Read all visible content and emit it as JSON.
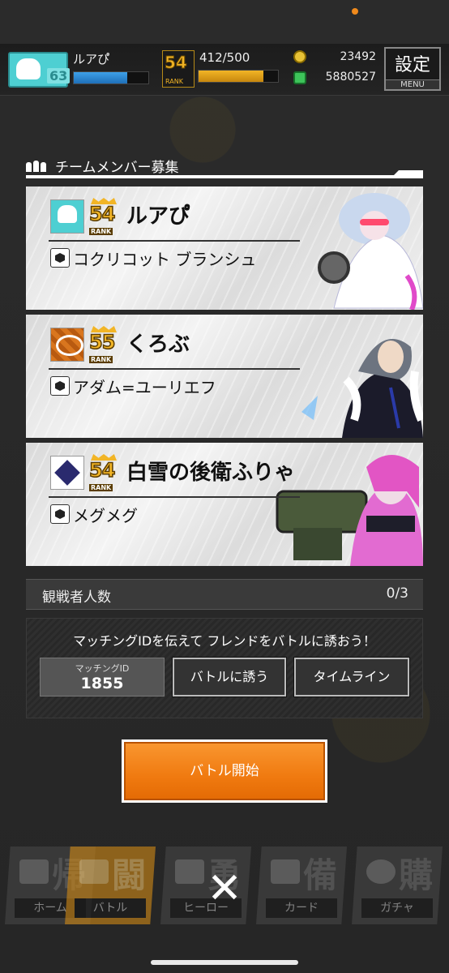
{
  "header": {
    "player_name": "ルアぴ゚",
    "level": "63",
    "xp_progress": 0.72,
    "rank_number": "54",
    "rank_label": "RANK",
    "rank_progress_text": "412/500",
    "rank_progress": 0.82,
    "coins": "23492",
    "cash": "5880527",
    "menu_big": "設定",
    "menu_small": "MENU"
  },
  "section": {
    "title": "チームメンバー募集"
  },
  "members": [
    {
      "name": "ルアぴ゚",
      "rank_number": "54",
      "rank_label": "RANK",
      "hero": "コクリコット ブランシュ",
      "avatar_color": "#4ecfd2"
    },
    {
      "name": "くろぶ",
      "rank_number": "55",
      "rank_label": "RANK",
      "hero": "アダム=ユーリエフ",
      "avatar_color": "#d9761e"
    },
    {
      "name": "白雪の後衛ふりゃ",
      "rank_number": "54",
      "rank_label": "RANK",
      "hero": "メグメグ",
      "avatar_color": "#2a2a6e"
    }
  ],
  "spectators": {
    "label": "観戦者人数",
    "count": "0/3"
  },
  "matching": {
    "message": "マッチングIDを伝えて フレンドをバトルに誘おう！",
    "id_label": "マッチングID",
    "id_value": "1855",
    "invite_button": "バトルに誘う",
    "timeline_button": "タイムライン"
  },
  "start_button": "バトル開始",
  "nav": {
    "tabs": [
      {
        "label": "ホーム",
        "kanji": "帰"
      },
      {
        "label": "バトル",
        "kanji": "闘"
      },
      {
        "label": "ヒーロー",
        "kanji": "勇"
      },
      {
        "label": "カード",
        "kanji": "備"
      },
      {
        "label": "ガチャ",
        "kanji": "購"
      }
    ],
    "close_symbol": "✕"
  },
  "colors": {
    "accent_orange": "#f07a10",
    "rank_gold": "#f2b526",
    "background": "#2a2a2a"
  }
}
